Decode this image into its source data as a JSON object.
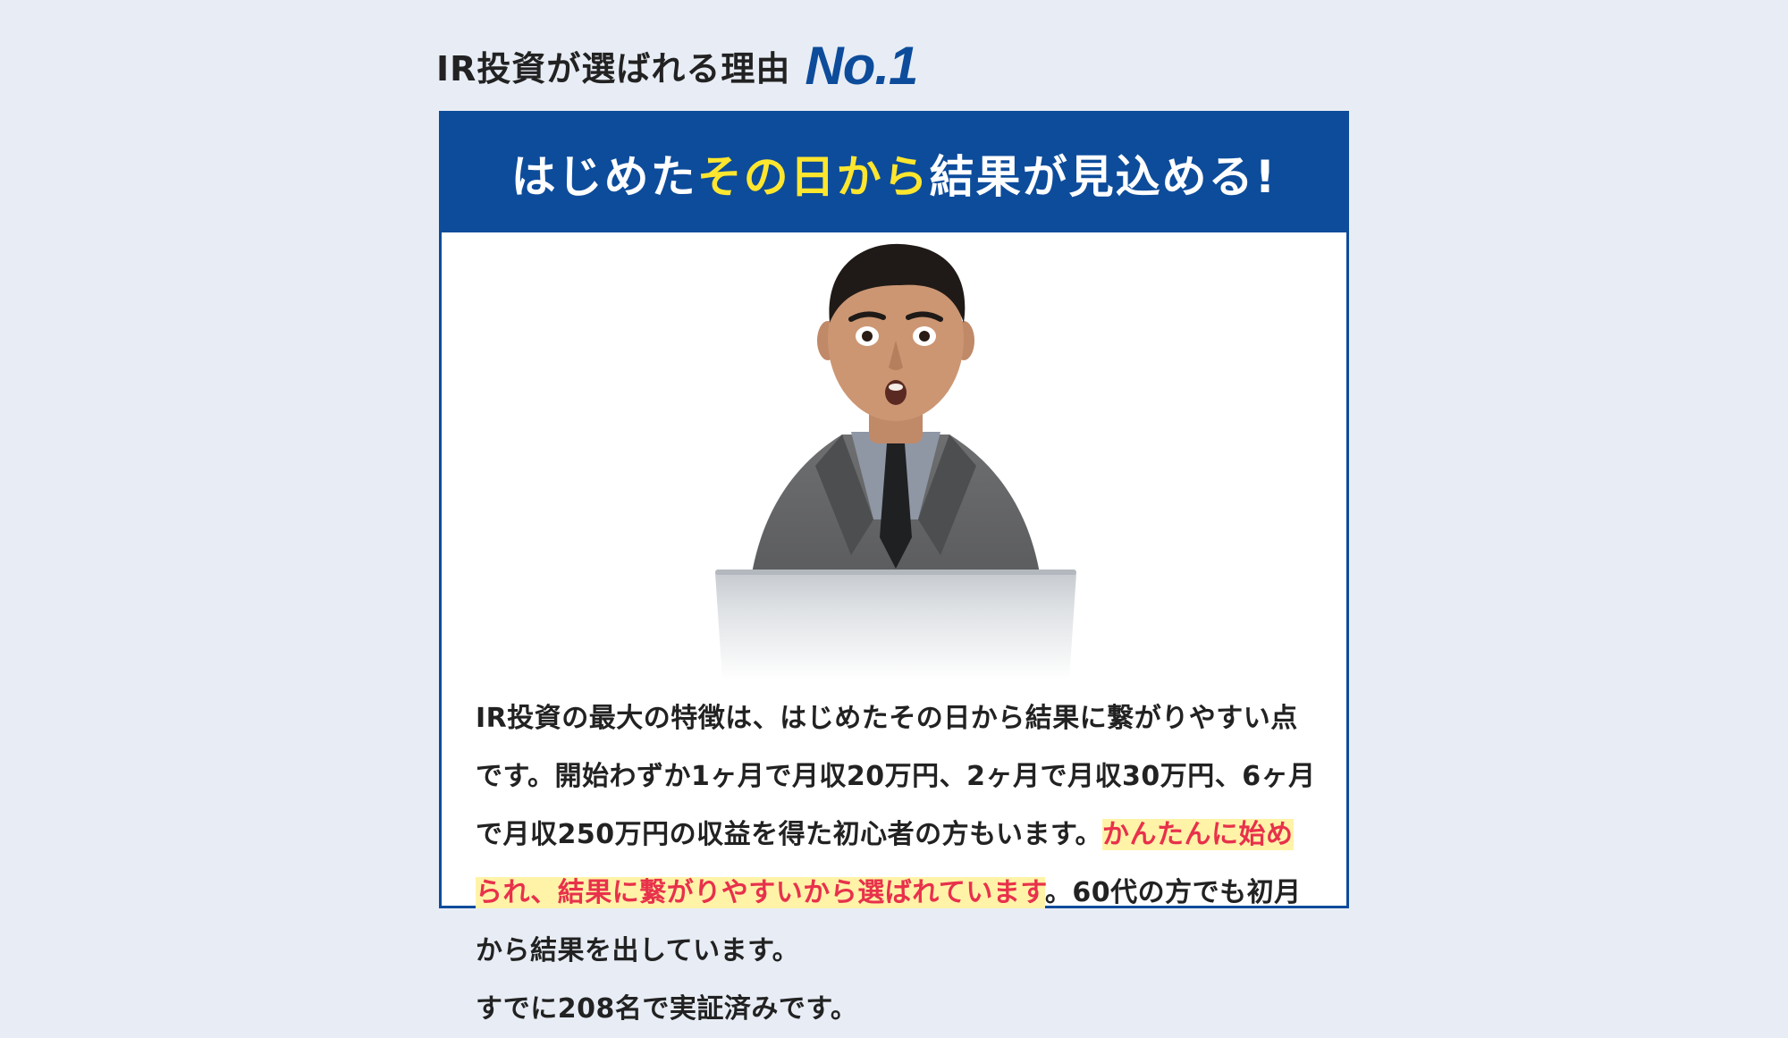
{
  "heading": {
    "text": "IR投資が選ばれる理由",
    "number": "No.1"
  },
  "card": {
    "title_part1": "はじめた",
    "title_highlight": "その日から",
    "title_part2": "結果が見込める!",
    "body_intro": "IR投資の最大の特徴は、はじめたその日から結果に繋がりやすい点です。開始わずか1ヶ月で月収20万円、2ヶ月で月収30万円、6ヶ月で月収250万円の収益を得た初心者の方もいます。",
    "body_highlight": "かんたんに始められ、結果に繋がりやすいから選ばれています",
    "body_outro": "。60代の方でも初月から結果を出しています。",
    "body_last": "すでに208名で実証済みです。"
  },
  "colors": {
    "background": "#e8edf5",
    "brand_blue": "#0d4c9b",
    "title_accent": "#ffe62e",
    "highlight_text": "#e8314b",
    "highlight_bg": "#fff3a8"
  }
}
